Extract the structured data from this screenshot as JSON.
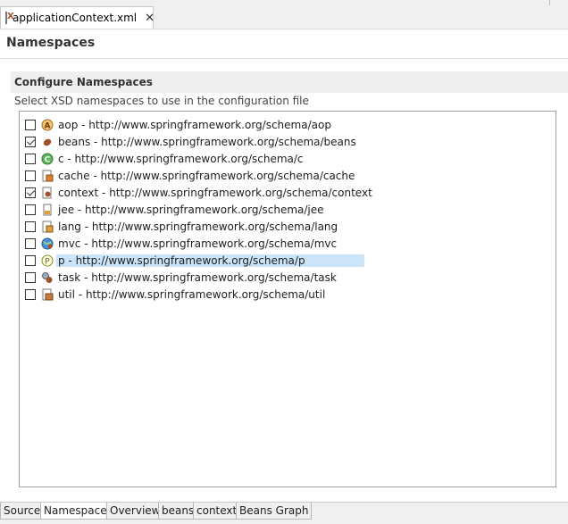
{
  "editor": {
    "tab_title": "applicationContext.xml",
    "close_symbol": "✕",
    "file_icon": "xml-file-icon"
  },
  "page": {
    "title": "Namespaces"
  },
  "section": {
    "title": "Configure Namespaces",
    "description": "Select XSD namespaces to use in the configuration file"
  },
  "namespaces": [
    {
      "label": "aop - http://www.springframework.org/schema/aop",
      "checked": false,
      "icon": "aop-icon"
    },
    {
      "label": "beans - http://www.springframework.org/schema/beans",
      "checked": true,
      "icon": "beans-icon"
    },
    {
      "label": "c - http://www.springframework.org/schema/c",
      "checked": false,
      "icon": "c-icon"
    },
    {
      "label": "cache - http://www.springframework.org/schema/cache",
      "checked": false,
      "icon": "cache-icon"
    },
    {
      "label": "context - http://www.springframework.org/schema/context",
      "checked": true,
      "icon": "context-icon"
    },
    {
      "label": "jee - http://www.springframework.org/schema/jee",
      "checked": false,
      "icon": "jee-icon"
    },
    {
      "label": "lang - http://www.springframework.org/schema/lang",
      "checked": false,
      "icon": "lang-icon"
    },
    {
      "label": "mvc - http://www.springframework.org/schema/mvc",
      "checked": false,
      "icon": "mvc-icon"
    },
    {
      "label": "p - http://www.springframework.org/schema/p",
      "checked": false,
      "icon": "p-icon",
      "selected": true
    },
    {
      "label": "task - http://www.springframework.org/schema/task",
      "checked": false,
      "icon": "task-icon"
    },
    {
      "label": "util - http://www.springframework.org/schema/util",
      "checked": false,
      "icon": "util-icon"
    }
  ],
  "bottom_tabs": [
    {
      "label": "Source",
      "active": false
    },
    {
      "label": "Namespaces",
      "active": true
    },
    {
      "label": "Overview",
      "active": false
    },
    {
      "label": "beans",
      "active": false
    },
    {
      "label": "context",
      "active": false
    },
    {
      "label": "Beans Graph",
      "active": false
    }
  ],
  "colors": {
    "selection": "#cce4f7",
    "section_bg": "#efefef",
    "tab_bar_bg": "#f0f0f0"
  }
}
